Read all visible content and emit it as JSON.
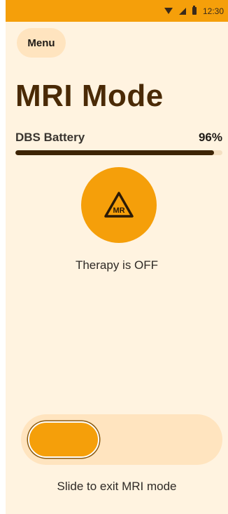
{
  "status_bar": {
    "time": "12:30"
  },
  "menu": {
    "label": "Menu"
  },
  "page": {
    "title": "MRI Mode"
  },
  "battery": {
    "label": "DBS Battery",
    "value_text": "96%",
    "level": 0.96
  },
  "mri_icon": {
    "name": "mr-conditional-icon",
    "text": "MR"
  },
  "therapy": {
    "status": "Therapy is OFF"
  },
  "slider": {
    "hint": "Slide to exit MRI mode",
    "position": 0
  },
  "colors": {
    "accent": "#f59f0a",
    "background": "#fff3e0",
    "soft_accent": "#ffe4bf",
    "title": "#4a2a06",
    "bar_fill": "#3d2404"
  }
}
